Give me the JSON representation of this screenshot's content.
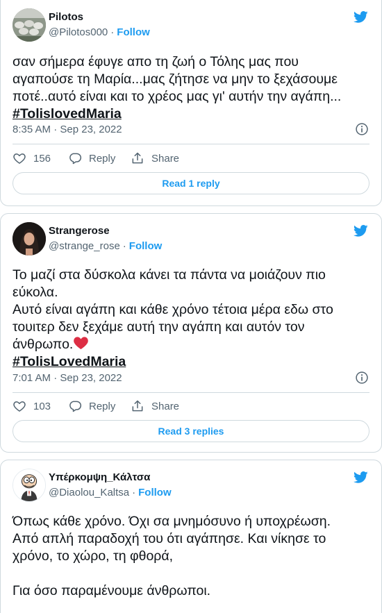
{
  "colors": {
    "accent": "#1d9bf0",
    "text": "#0f1419",
    "muted": "#536471",
    "border": "#cfd9de",
    "heart_emoji": "#dd2e44"
  },
  "tweets": [
    {
      "name": "Pilotos",
      "handle": "@Pilotos000",
      "follow": "Follow",
      "lines": [
        "σαν σήμερα έφυγε απο τη ζωή ο Τόλης μας που",
        "αγαπούσε τη Μαρία...μας ζήτησε να μην το ξεχάσουμε",
        "ποτέ..αυτό είναι και το χρέος μας γι' αυτήν την αγάπη..."
      ],
      "hashtag": "#TolislovedMaria",
      "timestamp": "8:35 AM · Sep 23, 2022",
      "likes": "156",
      "reply": "Reply",
      "share": "Share",
      "read_label": "Read 1 reply"
    },
    {
      "name": "Strangerose",
      "handle": "@strange_rose",
      "follow": "Follow",
      "lines": [
        "Το μαζί στα δύσκολα κάνει τα πάντα να μοιάζουν πιο",
        "εύκολα.",
        "Αυτό είναι αγάπη και κάθε χρόνο τέτοια μέρα εδω στο",
        "τουιτερ δεν ξεχάμε αυτή την αγάπη και αυτόν τον",
        "άνθρωπο."
      ],
      "hashtag": "#TolisLovedMaria",
      "timestamp": "7:01 AM · Sep 23, 2022",
      "likes": "103",
      "reply": "Reply",
      "share": "Share",
      "read_label": "Read 3 replies"
    },
    {
      "name": "Υπέρκομψη_Κάλτσα",
      "handle": "@Diaolou_Kaltsa",
      "follow": "Follow",
      "lines": [
        "Όπως κάθε χρόνο. Όχι σα μνημόσυνο ή υποχρέωση.",
        "Από απλή παραδοχή του ότι αγάπησε. Και νίκησε το",
        "χρόνο, το χώρο, τη φθορά,",
        "",
        "Για όσο παραμένουμε άνθρωποι."
      ]
    }
  ]
}
